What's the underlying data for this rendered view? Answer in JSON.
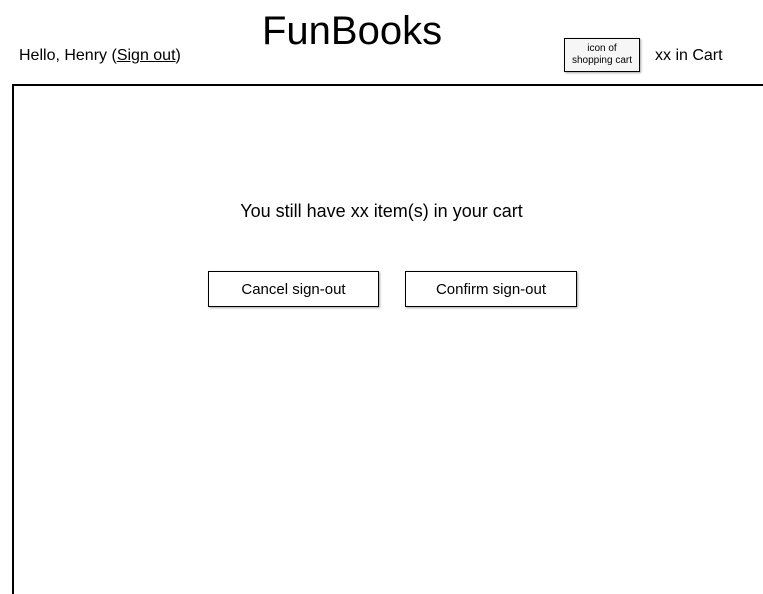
{
  "header": {
    "greeting_prefix": "Hello, Henry (",
    "sign_out_link": "Sign out",
    "greeting_suffix": ")",
    "app_title": "FunBooks",
    "cart_icon_label": "icon of\nshopping cart",
    "cart_count_text": "xx in Cart"
  },
  "main": {
    "message": "You still have xx item(s) in your cart",
    "cancel_button": "Cancel sign-out",
    "confirm_button": "Confirm sign-out"
  }
}
